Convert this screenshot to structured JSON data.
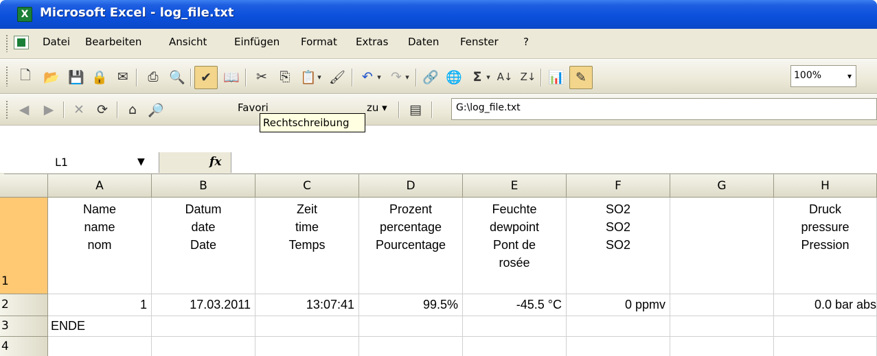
{
  "window": {
    "title": "Microsoft Excel - log_file.txt",
    "app_icon_glyph": "X"
  },
  "menu": {
    "items": [
      "Datei",
      "Bearbeiten",
      "Ansicht",
      "Einfügen",
      "Format",
      "Extras",
      "Daten",
      "Fenster",
      "?"
    ]
  },
  "toolbar": {
    "zoom": "100%",
    "tooltip": "Rechtschreibung",
    "favorites_label": "Favori",
    "goto_label": "zu ▾",
    "address": "G:\\log_file.txt"
  },
  "formula_bar": {
    "cell_ref": "L1",
    "fx_label": "fx",
    "formula": ""
  },
  "sheet": {
    "columns": [
      "A",
      "B",
      "C",
      "D",
      "E",
      "F",
      "G",
      "H"
    ],
    "rows": [
      {
        "num": "1",
        "cells": [
          [
            "Name",
            "name",
            "nom"
          ],
          [
            "Datum",
            "date",
            "Date"
          ],
          [
            "Zeit",
            "time",
            "Temps"
          ],
          [
            "Prozent",
            "percentage",
            "Pourcentage"
          ],
          [
            "Feuchte",
            "dewpoint",
            "Pont de",
            "rosée"
          ],
          [
            "SO2",
            "SO2",
            "SO2"
          ],
          [],
          [
            "Druck",
            "pressure",
            "Pression"
          ]
        ]
      },
      {
        "num": "2",
        "cells": [
          "1",
          "17.03.2011",
          "13:07:41",
          "99.5%",
          "-45.5 °C",
          "0 ppmv",
          "",
          "0.0 bar abs"
        ]
      },
      {
        "num": "3",
        "cells": [
          "ENDE",
          "",
          "",
          "",
          "",
          "",
          "",
          ""
        ]
      },
      {
        "num": "4",
        "cells": [
          "",
          "",
          "",
          "",
          "",
          "",
          "",
          ""
        ]
      }
    ]
  },
  "colors": {
    "titlebar": "#0b50dc",
    "row_header_selected": "#ffc873",
    "tooltip_bg": "#ffffe1"
  }
}
